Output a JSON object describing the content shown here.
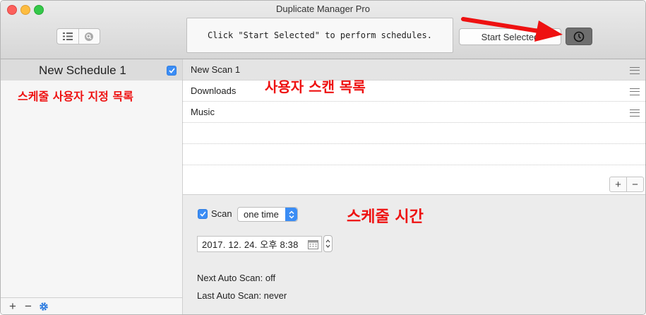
{
  "window": {
    "title": "Duplicate Manager Pro"
  },
  "toolbar": {
    "status_message": "Click \"Start Selected\" to perform schedules.",
    "start_label": "Start Selected"
  },
  "sidebar": {
    "schedules": [
      {
        "name": "New Schedule 1",
        "checked": true
      }
    ],
    "annotation": "스케줄 사용자 지정 목록",
    "footer": {
      "add": "+",
      "remove": "−"
    }
  },
  "scans": {
    "items": [
      {
        "label": "New Scan 1",
        "selected": true
      },
      {
        "label": "Downloads",
        "selected": false
      },
      {
        "label": "Music",
        "selected": false
      }
    ],
    "annotation": "사용자 스캔 목록",
    "add": "+",
    "remove": "−"
  },
  "detail": {
    "scan_label": "Scan",
    "scan_checked": true,
    "frequency": "one time",
    "datetime": "2017. 12. 24. 오후  8:38",
    "annotation": "스케줄 시간",
    "next_auto_scan": "Next Auto Scan: off",
    "last_auto_scan": "Last Auto Scan: never"
  },
  "colors": {
    "accent": "#3b8df5",
    "annotation": "#ee1111",
    "arrow": "#ee1111"
  },
  "icons": [
    "list-view-icon",
    "search-icon",
    "clock-icon",
    "gear-icon",
    "calendar-icon",
    "drag-handle-icon"
  ]
}
